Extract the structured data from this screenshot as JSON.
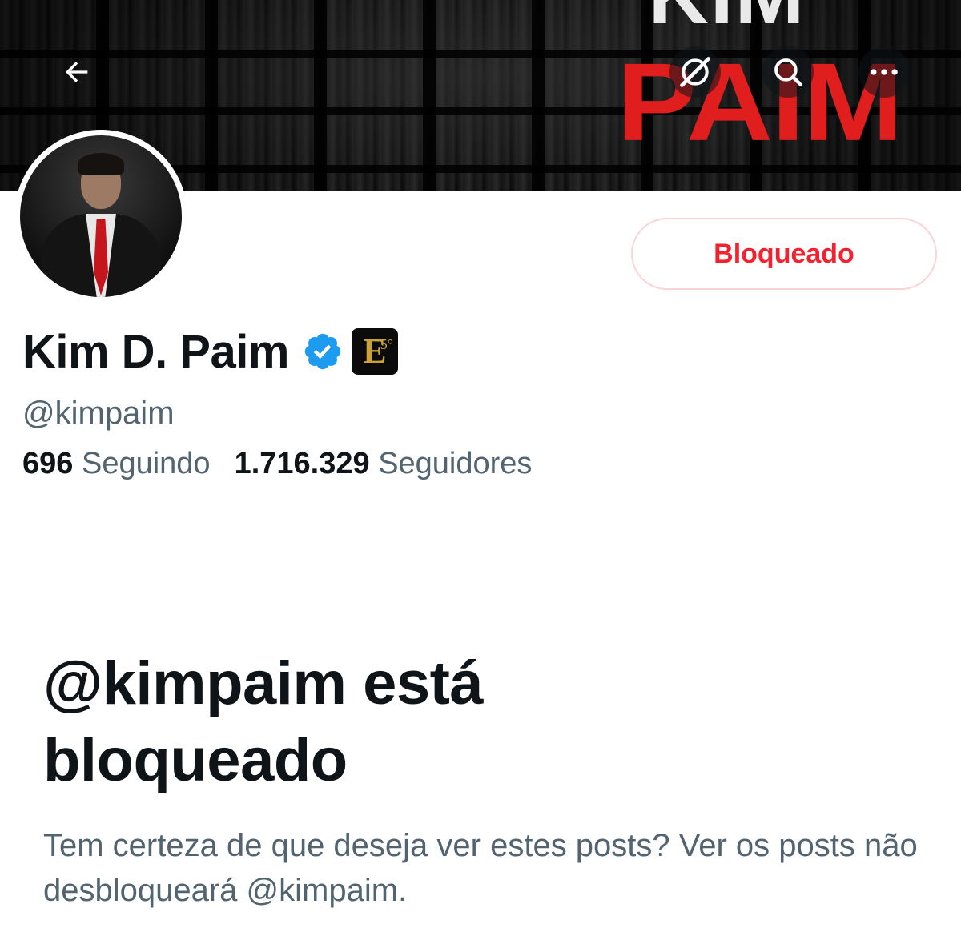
{
  "header": {
    "banner_text_top": "KIM",
    "banner_text_bottom": "PAIM",
    "icons": {
      "back": "arrow-left-icon",
      "grok": "grok-icon",
      "search": "search-icon",
      "more": "more-horizontal-icon"
    }
  },
  "profile": {
    "display_name": "Kim D. Paim",
    "handle": "@kimpaim",
    "verified_badge": "verified-badge-icon",
    "affiliate_badge": {
      "letter": "E",
      "superscript": "5°"
    },
    "blocked_button_label": "Bloqueado",
    "following_count": "696",
    "following_label": "Seguindo",
    "followers_count": "1.716.329",
    "followers_label": "Seguidores"
  },
  "blocked_notice": {
    "title": "@kimpaim está bloqueado",
    "description": "Tem certeza de que deseja ver estes posts? Ver os posts não desbloqueará @kimpaim."
  },
  "colors": {
    "text_primary": "#0f1419",
    "text_secondary": "#536471",
    "blocked_red": "#f4212e",
    "blocked_border": "#fcd3d6",
    "verified_blue": "#1d9bf0",
    "banner_red": "#e01e1e"
  }
}
